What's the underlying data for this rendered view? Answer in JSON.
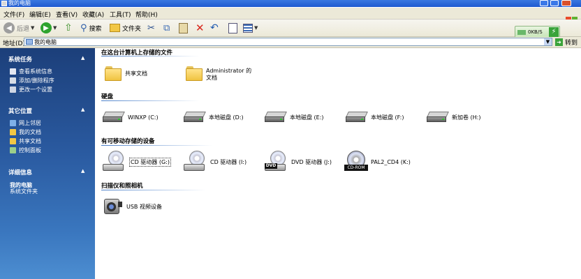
{
  "window": {
    "title": "我的电脑"
  },
  "menu": [
    "文件(F)",
    "编辑(E)",
    "查看(V)",
    "收藏(A)",
    "工具(T)",
    "帮助(H)"
  ],
  "toolbar": {
    "back": "后退",
    "search": "搜索",
    "folders": "文件夹",
    "net_speed": "0KB/S"
  },
  "address": {
    "label": "地址(D)",
    "value": "我的电脑",
    "go": "转到"
  },
  "colors": {
    "title_bar": "#2a62d9",
    "task_pane": "#2a5aa0",
    "group_line": "#4a7fc9"
  },
  "left_pane": {
    "system_tasks": {
      "title": "系统任务",
      "items": [
        "查看系统信息",
        "添加/删除程序",
        "更改一个设置"
      ]
    },
    "other_places": {
      "title": "其它位置",
      "items": [
        "网上邻居",
        "我的文档",
        "共享文档",
        "控制面板"
      ]
    },
    "details": {
      "title": "详细信息",
      "name": "我的电脑",
      "type": "系统文件夹"
    }
  },
  "content": {
    "files_group": "在这台计算机上存储的文件",
    "files": [
      "共享文档",
      "Administrator 的文档"
    ],
    "disks_group": "硬盘",
    "disks": [
      "WINXP (C:)",
      "本地磁盘 (D:)",
      "本地磁盘 (E:)",
      "本地磁盘 (F:)",
      "新加卷 (H:)"
    ],
    "removable_group": "有可移动存储的设备",
    "removable": [
      "CD 驱动器 (G:)",
      "CD 驱动器 (I:)",
      "DVD 驱动器 (J:)",
      "PAL2_CD4 (K:)"
    ],
    "removable_badges": {
      "dvd": "DVD",
      "cdrom": "CD-ROM"
    },
    "scanners_group": "扫描仪和照相机",
    "scanners": [
      "USB 视频设备"
    ]
  }
}
